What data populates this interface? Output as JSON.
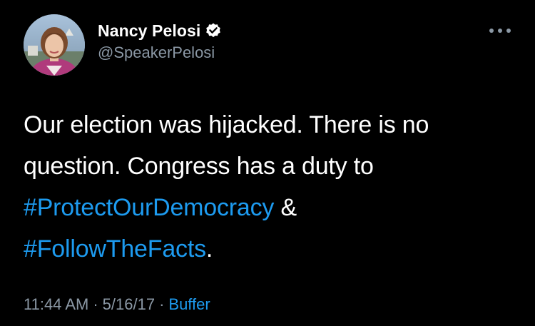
{
  "tweet": {
    "author": {
      "display_name": "Nancy Pelosi",
      "handle": "@SpeakerPelosi",
      "verified": true,
      "avatar_icon": "profile-photo"
    },
    "more_icon": "ellipsis-icon",
    "body": {
      "line1": "Our election was hijacked. There is no",
      "line2": "question. Congress has a duty to",
      "hashtag1": "#ProtectOurDemocracy",
      "ampersand": " &",
      "hashtag2": "#FollowTheFacts",
      "period": "."
    },
    "meta": {
      "time": "11:44 AM",
      "separator": "·",
      "date": "5/16/17",
      "source": "Buffer"
    }
  },
  "colors": {
    "background": "#000000",
    "text": "#ffffff",
    "secondary": "#8b98a5",
    "link": "#1d9bf0"
  }
}
